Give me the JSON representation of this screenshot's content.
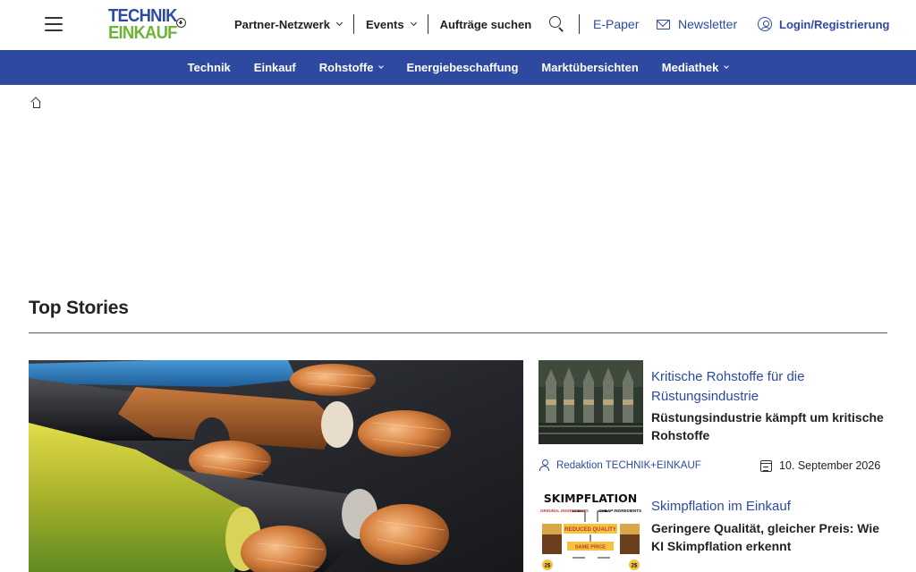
{
  "brand": {
    "logo_line1": "TECHNIK",
    "logo_line2": "EINKAUF",
    "color_primary": "#2d4aa0",
    "color_accent": "#6db43a"
  },
  "header": {
    "menu_icon": "hamburger-menu-icon",
    "nav": [
      {
        "label": "Partner-Netzwerk",
        "has_dropdown": true
      },
      {
        "label": "Events",
        "has_dropdown": true
      },
      {
        "label": "Aufträge suchen",
        "has_dropdown": false
      }
    ],
    "search_icon": "search-icon",
    "epaper_label": "E-Paper",
    "newsletter_label": "Newsletter",
    "login_label": "Login/Registrierung"
  },
  "categories": [
    {
      "label": "Technik",
      "has_dropdown": false
    },
    {
      "label": "Einkauf",
      "has_dropdown": false
    },
    {
      "label": "Rohstoffe",
      "has_dropdown": true
    },
    {
      "label": "Energiebeschaffung",
      "has_dropdown": false
    },
    {
      "label": "Marktübersichten",
      "has_dropdown": false
    },
    {
      "label": "Mediathek",
      "has_dropdown": true
    }
  ],
  "breadcrumb": {
    "home_icon": "home-icon"
  },
  "top_stories": {
    "title": "Top Stories",
    "side": [
      {
        "kicker": "Kritische Rohstoffe für die Rüstungsindustrie",
        "headline": "Rüstungsindustrie kämpft um kritische Rohstoffe",
        "author": "Redaktion TECHNIK+EINKAUF",
        "date": "10. September 2026"
      },
      {
        "kicker": "Skimpflation im Einkauf",
        "headline": "Geringere Qualität, gleicher Preis: Wie KI Skimpflation erkennt",
        "image_text": {
          "title": "SKIMPFLATION",
          "left_top": "ORIGINAL INGREDIENTS",
          "right_top": "CHEAP INGREDIENTS",
          "middle": "REDUCED QUALITY",
          "bottom": "SAME PRICE",
          "price": "2$"
        }
      }
    ]
  }
}
